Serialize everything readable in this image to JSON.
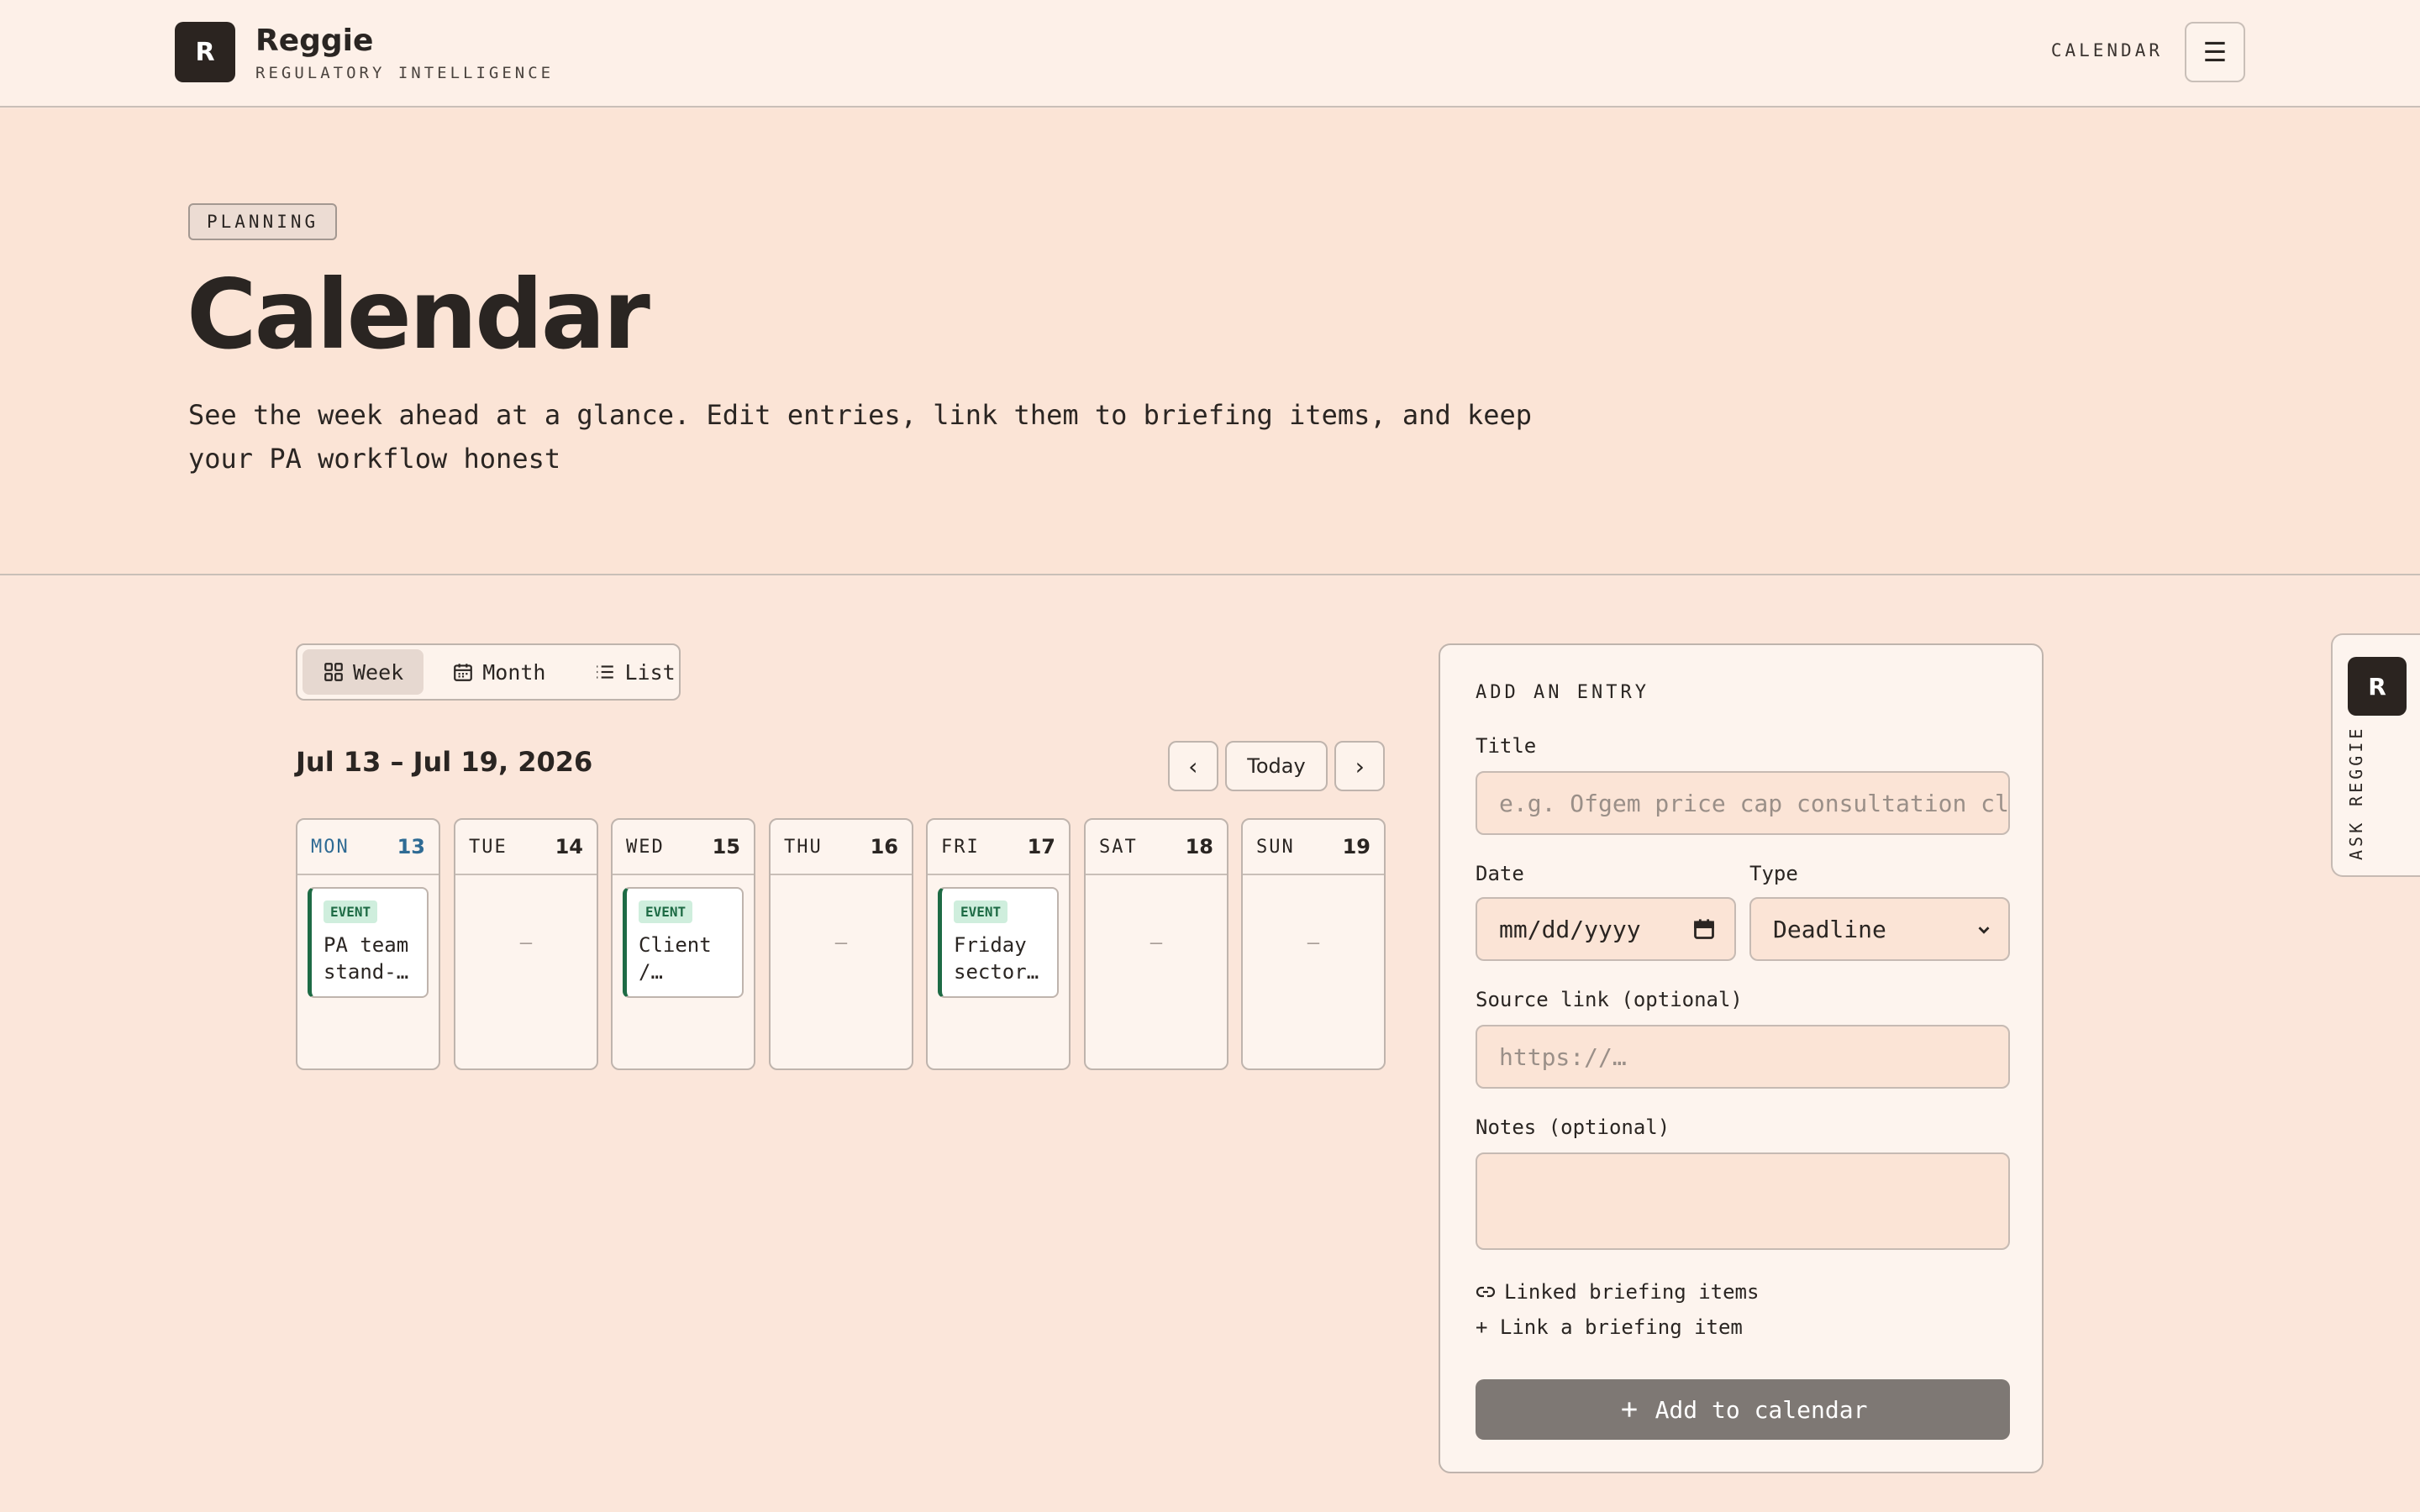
{
  "header": {
    "logo_letter": "R",
    "brand_name": "Reggie",
    "brand_sub": "REGULATORY INTELLIGENCE",
    "nav_calendar": "CALENDAR",
    "menu_icon": "☰"
  },
  "hero": {
    "badge": "PLANNING",
    "title": "Calendar",
    "description": "See the week ahead at a glance. Edit entries, link them to briefing items, and keep your PA workflow honest"
  },
  "view_toggle": {
    "week": "Week",
    "month": "Month",
    "list": "List",
    "active": "Week"
  },
  "range": {
    "label": "Jul 13 – Jul 19, 2026",
    "today": "Today",
    "prev_icon": "‹",
    "next_icon": "›"
  },
  "days": [
    {
      "name": "MON",
      "num": "13",
      "today": true,
      "event": {
        "tag": "EVENT",
        "title": "PA team stand-…"
      }
    },
    {
      "name": "TUE",
      "num": "14",
      "empty": "–"
    },
    {
      "name": "WED",
      "num": "15",
      "event": {
        "tag": "EVENT",
        "title": "Client /…"
      }
    },
    {
      "name": "THU",
      "num": "16",
      "empty": "–"
    },
    {
      "name": "FRI",
      "num": "17",
      "event": {
        "tag": "EVENT",
        "title": "Friday sector…"
      }
    },
    {
      "name": "SAT",
      "num": "18",
      "empty": "–"
    },
    {
      "name": "SUN",
      "num": "19",
      "empty": "–"
    }
  ],
  "entry": {
    "heading": "ADD AN ENTRY",
    "title_label": "Title",
    "title_placeholder": "e.g. Ofgem price cap consultation clo",
    "date_label": "Date",
    "date_placeholder": "mm/dd/yyyy",
    "type_label": "Type",
    "type_value": "Deadline",
    "source_label": "Source link (optional)",
    "source_placeholder": "https://…",
    "notes_label": "Notes (optional)",
    "linked_label": "Linked briefing items",
    "link_action": "+ Link a briefing item",
    "submit": "Add to calendar"
  },
  "ask": {
    "logo_letter": "R",
    "label": "ASK REGGIE"
  }
}
